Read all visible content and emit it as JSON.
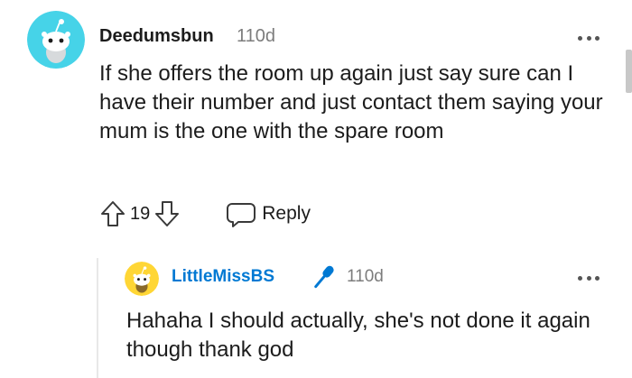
{
  "comments": [
    {
      "username": "Deedumsbun",
      "age": "110d",
      "text": "If she offers the room up again just say sure can I have their number and just contact them saying your mum is the one with the spare room",
      "votes": "19",
      "reply_label": "Reply"
    },
    {
      "username": "LittleMissBS",
      "age": "110d",
      "text": "Hahaha I should actually, she's not done it again though thank god"
    }
  ],
  "colors": {
    "avatar1_bg": "#46d3e8",
    "avatar2_bg": "#ffd635",
    "op_username": "#0079d3",
    "mic_icon": "#0079d3"
  },
  "icons": {
    "avatar": "reddit-snoo-avatar",
    "upvote": "upvote-arrow-icon",
    "downvote": "downvote-arrow-icon",
    "reply": "speech-bubble-icon",
    "more": "more-options-icon",
    "op_badge": "microphone-icon"
  }
}
